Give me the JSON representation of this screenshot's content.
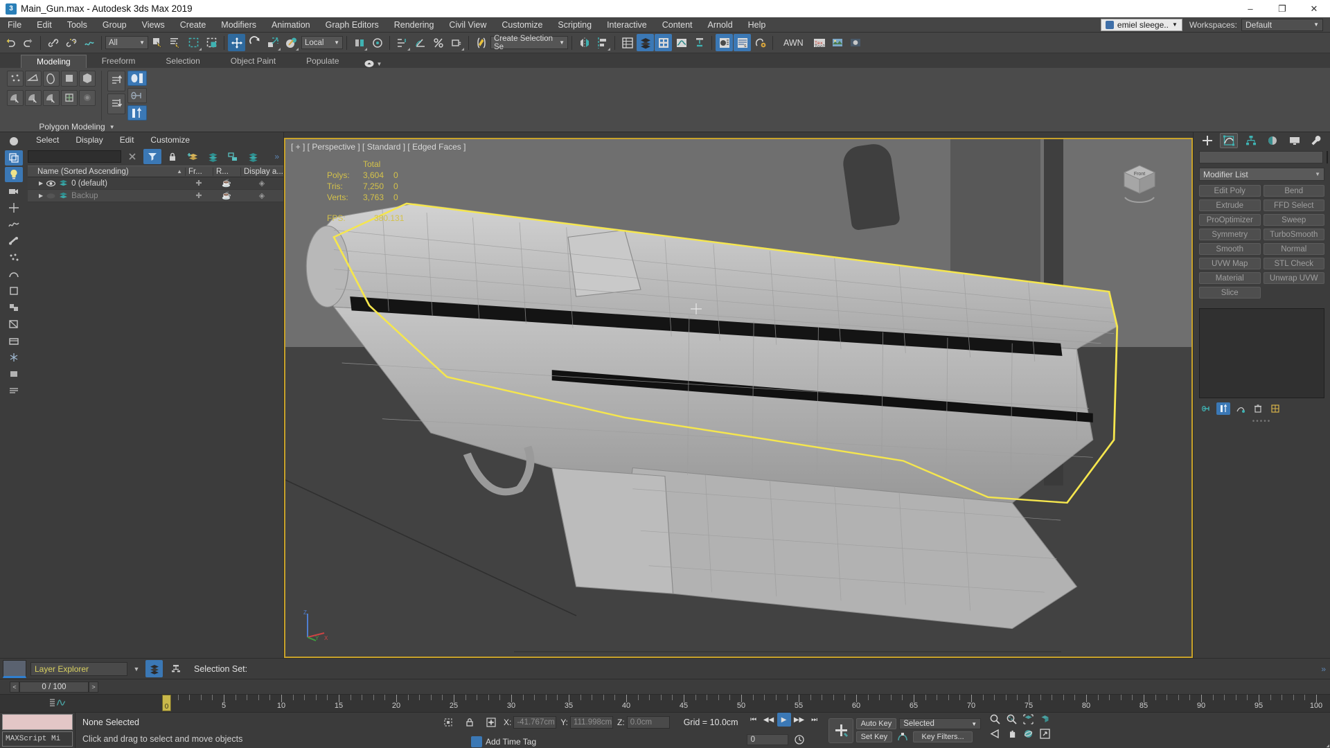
{
  "titlebar": {
    "app_icon": "3dsmax-icon",
    "title": "Main_Gun.max - Autodesk 3ds Max 2019",
    "minimize": "–",
    "maximize": "❐",
    "close": "✕"
  },
  "menubar": {
    "items": [
      {
        "label": "File"
      },
      {
        "label": "Edit"
      },
      {
        "label": "Tools"
      },
      {
        "label": "Group"
      },
      {
        "label": "Views"
      },
      {
        "label": "Create"
      },
      {
        "label": "Modifiers"
      },
      {
        "label": "Animation"
      },
      {
        "label": "Graph Editors"
      },
      {
        "label": "Rendering"
      },
      {
        "label": "Civil View"
      },
      {
        "label": "Customize"
      },
      {
        "label": "Scripting"
      },
      {
        "label": "Interactive"
      },
      {
        "label": "Content"
      },
      {
        "label": "Arnold"
      },
      {
        "label": "Help"
      }
    ],
    "user": "emiel sleege..",
    "workspaces_label": "Workspaces:",
    "workspace_value": "Default"
  },
  "toolbar": {
    "selection_filter": "All",
    "coordinate_system": "Local",
    "named_selection": "Create Selection Se",
    "awn_label": "AWN",
    "icons": [
      "undo-icon",
      "redo-icon",
      "select-link-icon",
      "unlink-icon",
      "bind-space-warp-icon",
      "selection-filter",
      "select-object-icon",
      "select-by-name-icon",
      "select-region-icon",
      "select-window-crossing-icon",
      "select-and-move-icon",
      "select-and-rotate-icon",
      "select-and-scale-icon",
      "select-and-place-icon",
      "coordinate-system",
      "mirror-icon",
      "align-icon",
      "quick-align-icon",
      "array-icon",
      "snaps-toggle-icon",
      "angle-snap-icon",
      "percent-snap-icon",
      "spinner-snap-icon",
      "named-selection-sets",
      "layer-manager-icon",
      "curve-editor-icon",
      "schematic-view-icon",
      "material-editor-icon",
      "render-setup-icon",
      "rendered-frame-icon",
      "render-production-icon",
      "render-iterative-icon",
      "activeshade-icon"
    ]
  },
  "ribbon": {
    "tabs": [
      {
        "label": "Modeling",
        "active": true
      },
      {
        "label": "Freeform",
        "active": false
      },
      {
        "label": "Selection",
        "active": false
      },
      {
        "label": "Object Paint",
        "active": false
      },
      {
        "label": "Populate",
        "active": false
      }
    ],
    "minimize_icon": "ribbon-minimize-icon",
    "panel_label": "Polygon Modeling",
    "row1_icons": [
      "vertex-subobject-icon",
      "edge-subobject-icon",
      "border-subobject-icon",
      "polygon-subobject-icon",
      "element-subobject-icon"
    ],
    "row2_icons": [
      "generate-topology-icon",
      "repeat-last-icon",
      "preserve-uvs-icon",
      "poly-object-icon",
      "swift-loop-icon"
    ],
    "side_icons": [
      "collapse-stack-up-icon",
      "collapse-stack-down-icon"
    ],
    "right_icons": [
      "show-cage-icon",
      "pin-stack-icon",
      "make-planar-icon"
    ]
  },
  "explorer": {
    "menu": [
      "Select",
      "Display",
      "Edit",
      "Customize"
    ],
    "search_placeholder": "",
    "toolbar_icons": [
      "clear-search-icon",
      "filter-icon",
      "lock-icon",
      "add-layer-icon",
      "layers-icon",
      "select-children-icon",
      "layer-stack-icon",
      "overflow-icon"
    ],
    "columns": [
      {
        "label": "Name (Sorted Ascending)"
      },
      {
        "label": "Fr..."
      },
      {
        "label": "R..."
      },
      {
        "label": "Display a..."
      }
    ],
    "rows": [
      {
        "name": "0 (default)",
        "dim": false,
        "visible_icon": "eye-open-icon",
        "freeze_icon": "freeze-icon",
        "render_icon": "render-teapot-icon",
        "display_icon": "display-box-icon"
      },
      {
        "name": "Backup",
        "dim": true,
        "visible_icon": "eye-closed-icon",
        "freeze_icon": "freeze-icon",
        "render_icon": "render-teapot-icon",
        "display_icon": "display-box-icon"
      }
    ],
    "side_icons": [
      "select-object-icon",
      "select-similar-icon",
      "light-icon",
      "camera-icon",
      "helper-icon",
      "space-warp-icon",
      "bone-icon",
      "particle-icon",
      "shape-icon",
      "geometry-icon",
      "group-icon",
      "xref-icon",
      "container-icon",
      "freeze-icon",
      "hide-icon",
      "expand-icon"
    ]
  },
  "viewport": {
    "label": "[ + ] [ Perspective ] [ Standard ] [ Edged Faces ]",
    "stats": {
      "header_total": "Total",
      "rows": [
        {
          "label": "Polys:",
          "total": "3,604",
          "selection": "0"
        },
        {
          "label": "Tris:",
          "total": "7,250",
          "selection": "0"
        },
        {
          "label": "Verts:",
          "total": "3,763",
          "selection": "0"
        }
      ],
      "fps_label": "FPS:",
      "fps_value": "380.131"
    },
    "axis_labels": {
      "z": "Z",
      "x": "X",
      "y": "Y"
    },
    "viewcube_label": "Front"
  },
  "command_panel": {
    "tabs": [
      {
        "icon": "create-tab-icon",
        "active": false
      },
      {
        "icon": "modify-tab-icon",
        "active": true
      },
      {
        "icon": "hierarchy-tab-icon",
        "active": false
      },
      {
        "icon": "motion-tab-icon",
        "active": false
      },
      {
        "icon": "display-tab-icon",
        "active": false
      },
      {
        "icon": "utilities-tab-icon",
        "active": false
      }
    ],
    "object_name": "",
    "modifier_list_label": "Modifier List",
    "modifier_buttons": [
      "Edit Poly",
      "Bend",
      "Extrude",
      "FFD Select",
      "ProOptimizer",
      "Sweep",
      "Symmetry",
      "TurboSmooth",
      "Smooth",
      "Normal",
      "UVW Map",
      "STL Check",
      "Material",
      "Unwrap UVW",
      "Slice"
    ],
    "stack_icons": [
      "pin-stack-icon",
      "show-end-result-icon",
      "make-unique-icon",
      "remove-modifier-icon",
      "configure-sets-icon"
    ]
  },
  "bottom": {
    "layer_explorer_value": "Layer Explorer",
    "layer_icons": [
      "layer-manager-icon",
      "schematic-icon"
    ],
    "selection_set_label": "Selection Set:",
    "frame_field": "0 / 100",
    "prev_frame": "<",
    "next_frame": ">",
    "ruler_max": 100,
    "ruler_ticks": [
      0,
      5,
      10,
      15,
      20,
      25,
      30,
      35,
      40,
      45,
      50,
      55,
      60,
      65,
      70,
      75,
      80,
      85,
      90,
      95,
      100
    ],
    "playhead_frame": "0"
  },
  "statusbar": {
    "maxscript_label": "MAXScript Mi",
    "status_line1": "None Selected",
    "status_line2": "Click and drag to select and move objects",
    "coords": [
      {
        "axis": "X:",
        "value": "-41.767cm"
      },
      {
        "axis": "Y:",
        "value": "111.998cm"
      },
      {
        "axis": "Z:",
        "value": "0.0cm"
      }
    ],
    "grid_label": "Grid = 10.0cm",
    "add_time_tag": "Add Time Tag",
    "auto_key": "Auto Key",
    "set_key": "Set Key",
    "key_mode_value": "Selected",
    "key_filters": "Key Filters...",
    "frame_spinner": "0",
    "playback_icons": [
      "go-to-start-icon",
      "prev-frame-icon",
      "play-icon",
      "next-frame-icon",
      "go-to-end-icon"
    ],
    "nav_icons": [
      "zoom-icon",
      "zoom-all-icon",
      "zoom-extents-icon",
      "zoom-region-icon",
      "field-of-view-icon",
      "pan-icon",
      "orbit-icon",
      "maximize-viewport-icon"
    ],
    "left_icons": [
      "selection-lock-icon",
      "absolute-relative-icon",
      "transform-type-in-icon"
    ]
  },
  "colors": {
    "accent_blue": "#3b78b5",
    "viewport_border": "#c8a22a",
    "selection_yellow": "#f3e55c",
    "stats_yellow": "#d4c24a",
    "panel_bg": "#3c3c3c",
    "toolbar_bg": "#454545"
  }
}
